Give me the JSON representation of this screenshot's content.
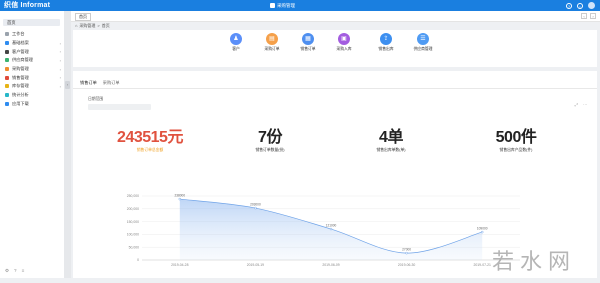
{
  "header": {
    "logo": "织信 Informat",
    "app_title": "采购管理",
    "icons": [
      "help-icon",
      "bell-icon",
      "avatar"
    ]
  },
  "tabbar": {
    "home_tab": "首页",
    "tools": [
      "‹",
      "›"
    ]
  },
  "breadcrumb": {
    "root": "采购管理",
    "separator": ">",
    "current": "首页"
  },
  "sidebar": {
    "home": "首页",
    "items": [
      {
        "label": "工作台",
        "icon": "workbench-icon",
        "color": "#9aa3ad",
        "arrow": ""
      },
      {
        "label": "基础档案",
        "icon": "folder-icon",
        "color": "#2f8cf0",
        "arrow": "›"
      },
      {
        "label": "客户管理",
        "icon": "user-icon",
        "color": "#444444",
        "arrow": "›"
      },
      {
        "label": "供应商管理",
        "icon": "truck-icon",
        "color": "#3cb371",
        "arrow": "›"
      },
      {
        "label": "采购管理",
        "icon": "cart-icon",
        "color": "#f08c2e",
        "arrow": "›"
      },
      {
        "label": "销售管理",
        "icon": "sale-icon",
        "color": "#e04a3a",
        "arrow": "›"
      },
      {
        "label": "库存管理",
        "icon": "box-icon",
        "color": "#e7b416",
        "arrow": "›"
      },
      {
        "label": "统计分析",
        "icon": "chart-icon",
        "color": "#28b7c8",
        "arrow": ""
      },
      {
        "label": "应用下载",
        "icon": "download-icon",
        "color": "#2f8cf0",
        "arrow": ""
      }
    ],
    "bottom_icons": [
      "⚙",
      "?",
      "≡"
    ]
  },
  "quick_links": [
    {
      "label": "客户",
      "icon": "customer-icon",
      "glyph": "♟",
      "color": "#5b8ff9"
    },
    {
      "label": "采购订单",
      "icon": "purchase-order-icon",
      "glyph": "▤",
      "color": "#f5a04a"
    },
    {
      "label": "销售订单",
      "icon": "sales-order-icon",
      "glyph": "▦",
      "color": "#4e8ff0"
    },
    {
      "label": "采购入库",
      "icon": "stock-in-icon",
      "glyph": "▣",
      "color": "#a35de0"
    },
    {
      "label": "销售出库",
      "icon": "stock-out-icon",
      "glyph": "⇪",
      "color": "#3d8ff0"
    },
    {
      "label": "供应商管理",
      "icon": "supplier-icon",
      "glyph": "☰",
      "color": "#4f9bf3"
    }
  ],
  "report": {
    "tabs": [
      "销售订单",
      "采购订单"
    ],
    "active_tab": 0,
    "range_label": "日期范围",
    "tools": [
      "⤢",
      "⋯"
    ],
    "stats": [
      {
        "value": "243515元",
        "label": "销售订单总金额",
        "color": "#e0523f",
        "label_color": "#f0a020"
      },
      {
        "value": "7份",
        "label": "销售订单数量(份)",
        "color": "#222222",
        "label_color": "#333333"
      },
      {
        "value": "4单",
        "label": "销售出库单数(单)",
        "color": "#222222",
        "label_color": "#333333"
      },
      {
        "value": "500件",
        "label": "销售出库产品数(件)",
        "color": "#222222",
        "label_color": "#333333"
      }
    ]
  },
  "chart_data": {
    "type": "area",
    "title": "",
    "xlabel": "",
    "ylabel": "",
    "categories": [
      "2019-04-28",
      "2019-05-19",
      "2019-06-09",
      "2019-06-30",
      "2019-07-21"
    ],
    "series": [
      {
        "values": [
          238000,
          203000,
          121000,
          27000,
          109000
        ],
        "color": "#6fa3e8"
      }
    ],
    "ylim": [
      0,
      250000
    ],
    "yticks": [
      "0",
      "50,000",
      "100,000",
      "150,000",
      "200,000",
      "250,000"
    ],
    "grid": true
  },
  "watermark": "若水网"
}
